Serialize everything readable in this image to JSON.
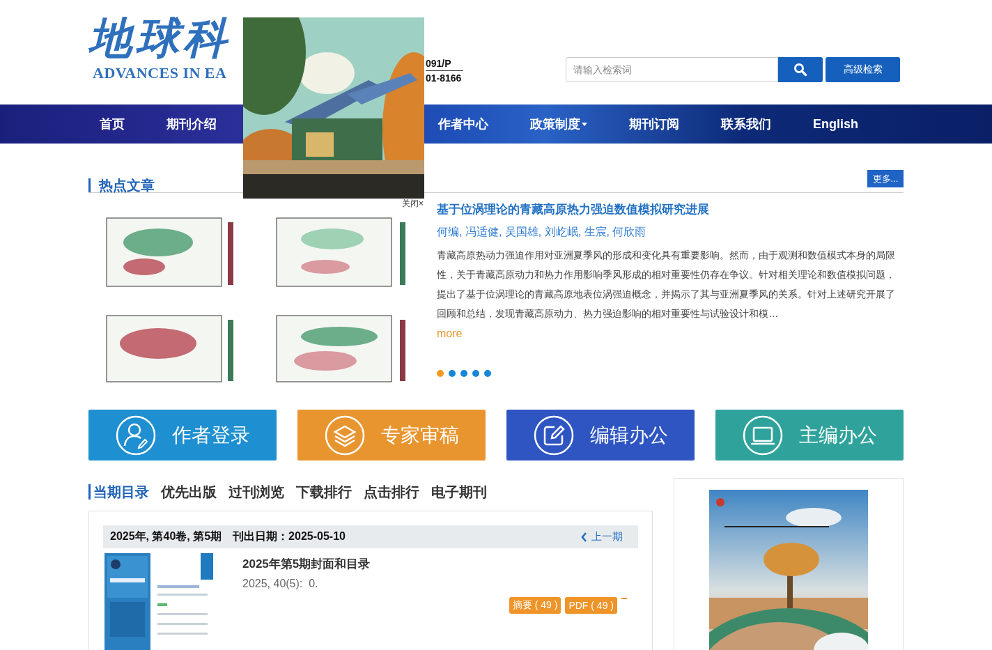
{
  "header": {
    "logo_title": "地球科",
    "logo_subtitle": "ADVANCES IN EA",
    "issn_lines": [
      "091/P",
      "01-8166"
    ],
    "search": {
      "placeholder": "请输入检索词",
      "advanced_button": "高级检索"
    }
  },
  "popup": {
    "close": "关闭×"
  },
  "nav": {
    "items": [
      {
        "label": "首页",
        "dropdown": false
      },
      {
        "label": "期刊介绍",
        "dropdown": false
      },
      {
        "label": "作者中心",
        "dropdown": false
      },
      {
        "label": "政策制度",
        "dropdown": true
      },
      {
        "label": "期刊订阅",
        "dropdown": false
      },
      {
        "label": "联系我们",
        "dropdown": false
      },
      {
        "label": "English",
        "dropdown": false
      }
    ]
  },
  "hot_articles": {
    "title": "热点文章",
    "more_button": "更多...",
    "article": {
      "title": "基于位涡理论的青藏高原热力强迫数值模拟研究进展",
      "authors": "何编, 冯适健, 吴国雄, 刘屹岷, 生宸, 何欣雨",
      "abstract": "青藏高原热动力强迫作用对亚洲夏季风的形成和变化具有重要影响。然而，由于观测和数值模式本身的局限性，关于青藏高原动力和热力作用影响季风形成的相对重要性仍存在争议。针对相关理论和数值模拟问题，提出了基于位涡理论的青藏高原地表位涡强迫概念，并揭示了其与亚洲夏季风的关系。针对上述研究开展了回顾和总结，发现青藏高原动力、热力强迫影响的相对重要性与试验设计和模…",
      "more": "more"
    },
    "carousel_dots": [
      {
        "selected": true
      },
      {
        "selected": false
      },
      {
        "selected": false
      },
      {
        "selected": false
      },
      {
        "selected": false
      }
    ]
  },
  "quick_links": [
    {
      "label": "作者登录",
      "kind": "person",
      "color": "#1e8fd0"
    },
    {
      "label": "专家审稿",
      "kind": "layers",
      "color": "#e8952f"
    },
    {
      "label": "编辑办公",
      "kind": "edit",
      "color": "#2e55c2"
    },
    {
      "label": "主编办公",
      "kind": "monitor",
      "color": "#2fa39b"
    }
  ],
  "issue_tabs": [
    {
      "label": "当期目录",
      "selected": true
    },
    {
      "label": "优先出版",
      "selected": false
    },
    {
      "label": "过刊浏览",
      "selected": false
    },
    {
      "label": "下载排行",
      "selected": false
    },
    {
      "label": "点击排行",
      "selected": false
    },
    {
      "label": "电子期刊",
      "selected": false
    }
  ],
  "current_issue": {
    "heading": "2025年, 第40卷, 第5期",
    "date": "刊出日期：2025-05-10",
    "prev_link": "上一期",
    "items": [
      {
        "title": "2025年第5期封面和目录",
        "meta": "2025, 40(5):  0.",
        "buttons": [
          "摘要 ( 49 )",
          "PDF ( 49 )"
        ]
      }
    ]
  }
}
